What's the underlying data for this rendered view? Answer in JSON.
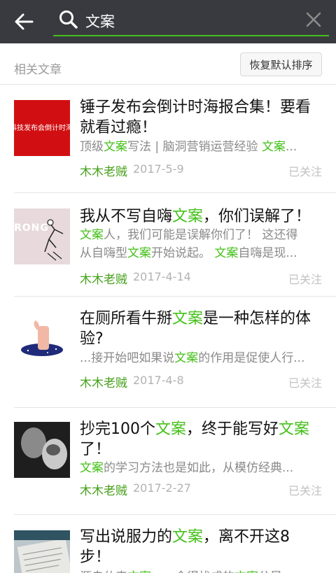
{
  "search": {
    "query": "文案"
  },
  "section": {
    "title": "相关文章",
    "restore_label": "恢复默认排序"
  },
  "articles": [
    {
      "title_parts": [
        {
          "t": "锤子发布会倒计时海报合集！要看就看过瘾！",
          "h": false
        }
      ],
      "snippet_parts": [
        {
          "t": "顶级",
          "h": false
        },
        {
          "t": "文案",
          "h": true
        },
        {
          "t": "写法 | 脑洞营销运营经验 ",
          "h": false
        },
        {
          "t": "文案",
          "h": true
        },
        {
          "t": "...",
          "h": false
        }
      ],
      "author": "木木老贼",
      "date": "2017-5-9",
      "status": "已关注",
      "thumb_text": "科技发布会倒计时海报"
    },
    {
      "title_parts": [
        {
          "t": "我从不写自嗨",
          "h": false
        },
        {
          "t": "文案",
          "h": true
        },
        {
          "t": "，你们误解了！",
          "h": false
        }
      ],
      "snippet_parts": [
        {
          "t": "文案",
          "h": true
        },
        {
          "t": "人，我们可能是误解你们了！ 这还得",
          "h": false
        }
      ],
      "snippet2_parts": [
        {
          "t": "从自嗨型",
          "h": false
        },
        {
          "t": "文案",
          "h": true
        },
        {
          "t": "开始说起。 ",
          "h": false
        },
        {
          "t": "文案",
          "h": true
        },
        {
          "t": "自嗨是现...",
          "h": false
        }
      ],
      "author": "木木老贼",
      "date": "2017-4-14",
      "status": "已关注",
      "thumb_text": "RONG"
    },
    {
      "title_parts": [
        {
          "t": "在厕所看牛掰",
          "h": false
        },
        {
          "t": "文案",
          "h": true
        },
        {
          "t": "是一种怎样的体验?",
          "h": false
        }
      ],
      "snippet_parts": [
        {
          "t": "...接开始吧如果说",
          "h": false
        },
        {
          "t": "文案",
          "h": true
        },
        {
          "t": "的作用是促使人行...",
          "h": false
        }
      ],
      "author": "木木老贼",
      "date": "2017-4-8",
      "status": "已关注"
    },
    {
      "title_parts": [
        {
          "t": "抄完100个",
          "h": false
        },
        {
          "t": "文案",
          "h": true
        },
        {
          "t": "，终于能写好",
          "h": false
        },
        {
          "t": "文案",
          "h": true
        },
        {
          "t": "了！",
          "h": false
        }
      ],
      "snippet_parts": [
        {
          "t": "文案",
          "h": true
        },
        {
          "t": "的学习方法也是如此，从模仿经典...",
          "h": false
        }
      ],
      "author": "木木老贼",
      "date": "2017-2-27",
      "status": "已关注"
    },
    {
      "title_parts": [
        {
          "t": "写出说服力的",
          "h": false
        },
        {
          "t": "文案",
          "h": true
        },
        {
          "t": "，离不开这8步！",
          "h": false
        }
      ],
      "snippet_parts": [
        {
          "t": "源自仕来",
          "h": false
        },
        {
          "t": "文案",
          "h": true
        },
        {
          "t": "……今得找成的",
          "h": false
        },
        {
          "t": "文案",
          "h": true
        },
        {
          "t": "分是",
          "h": false
        }
      ]
    }
  ],
  "colors": {
    "topbar": "#393a3f",
    "accent": "#45c01a",
    "author": "#45a01a",
    "thumb_red": "#d10f12"
  }
}
